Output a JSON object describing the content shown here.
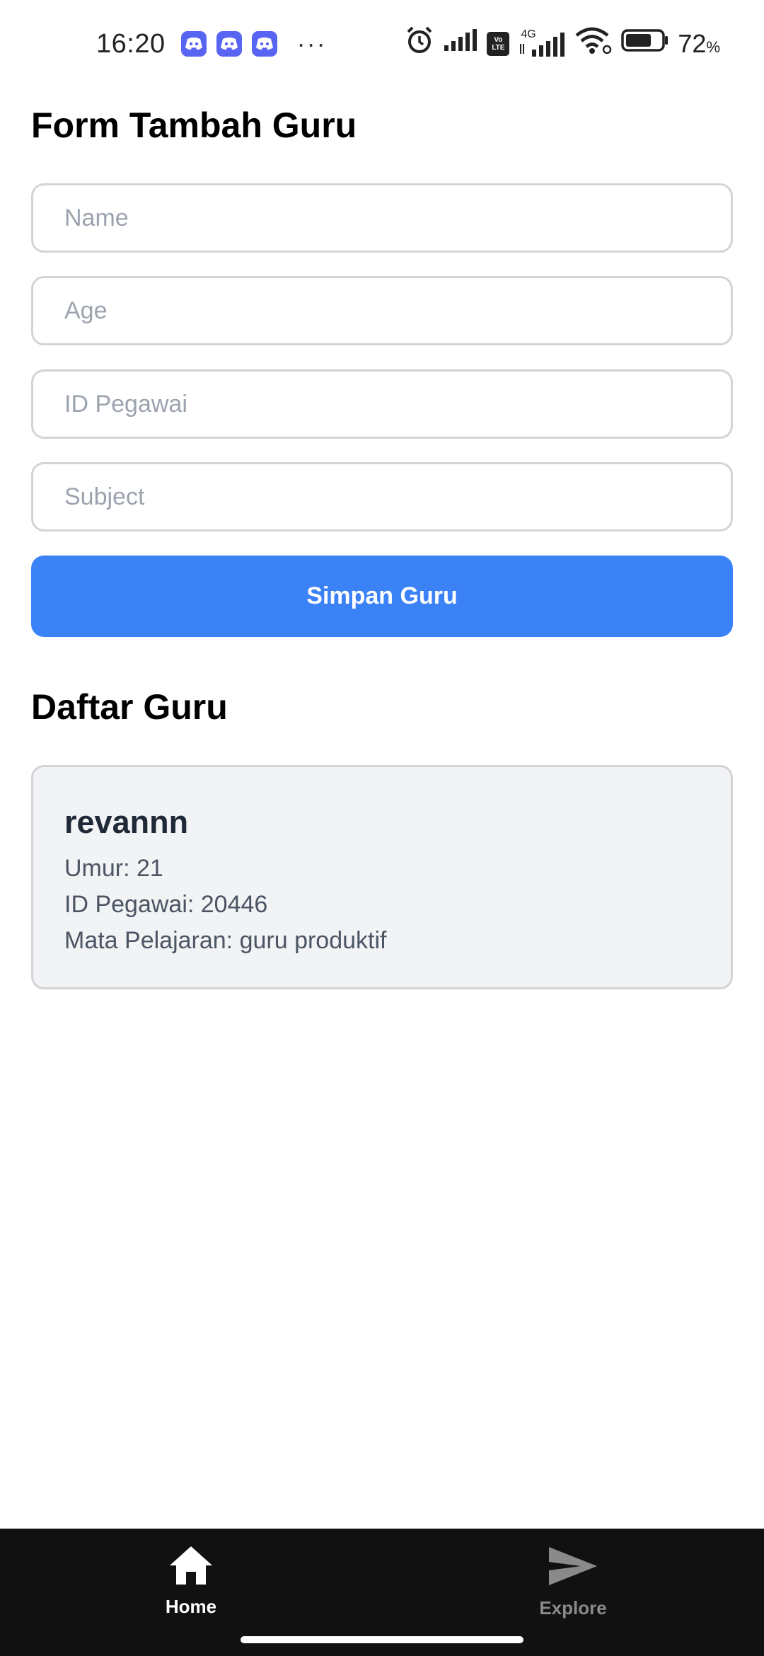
{
  "status_bar": {
    "time": "16:20",
    "notification_icons": [
      "discord-icon",
      "discord-icon",
      "discord-icon"
    ],
    "more": "···",
    "network_4g": "4G",
    "volte": "Vo LTE",
    "battery_level": 72,
    "battery_text": "72",
    "battery_unit": "%"
  },
  "form": {
    "title": "Form Tambah Guru",
    "name_placeholder": "Name",
    "age_placeholder": "Age",
    "id_placeholder": "ID Pegawai",
    "subject_placeholder": "Subject",
    "submit_label": "Simpan Guru",
    "accent_color": "#3b82f6"
  },
  "list": {
    "title": "Daftar Guru",
    "items": [
      {
        "name": "revannn",
        "age_line": "Umur: 21",
        "id_line": "ID Pegawai: 20446",
        "subject_line": "Mata Pelajaran: guru produktif"
      }
    ]
  },
  "bottom_nav": {
    "items": [
      {
        "label": "Home",
        "icon": "home-icon",
        "active": true
      },
      {
        "label": "Explore",
        "icon": "send-icon",
        "active": false
      }
    ]
  }
}
